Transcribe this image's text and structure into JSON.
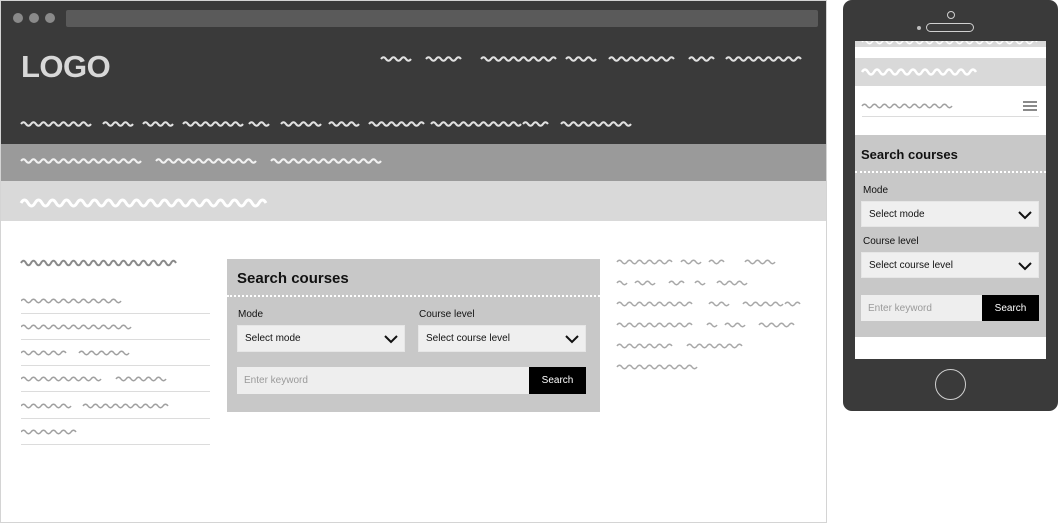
{
  "brand": {
    "logo_text": "LOGO"
  },
  "desktop_search": {
    "title": "Search courses",
    "mode_label": "Mode",
    "mode_value": "Select mode",
    "level_label": "Course level",
    "level_value": "Select course level",
    "keyword_placeholder": "Enter keyword",
    "button_label": "Search"
  },
  "mobile_search": {
    "title": "Search courses",
    "mode_label": "Mode",
    "mode_value": "Select mode",
    "level_label": "Course level",
    "level_value": "Select course level",
    "keyword_placeholder": "Enter keyword",
    "button_label": "Search"
  },
  "icons": {
    "chevron": "chevron-down-icon",
    "menu": "hamburger-menu-icon"
  },
  "colors": {
    "chrome": "#3a3a3a",
    "nav_mid": "#9a9a9a",
    "nav_light": "#d9d9d9",
    "panel": "#c8c8c8",
    "button": "#000000"
  }
}
